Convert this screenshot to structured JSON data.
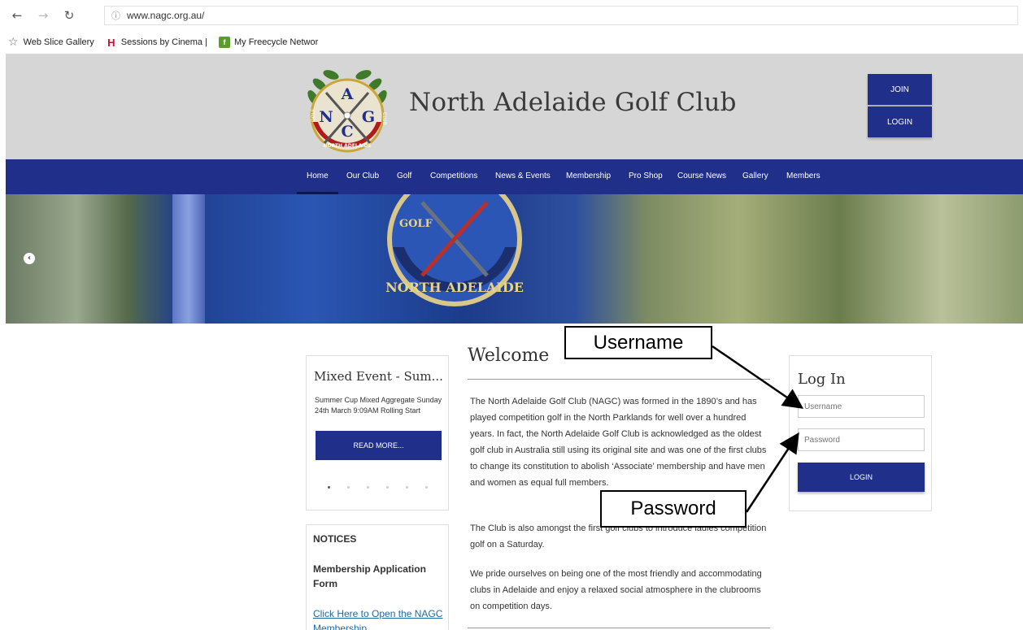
{
  "browser": {
    "back_glyph": "←",
    "forward_glyph": "→",
    "reload_glyph": "↻",
    "info_glyph": "ⓘ",
    "url": "www.nagc.org.au/",
    "favorites_star": "☆",
    "favorites": [
      {
        "label": "Web Slice Gallery",
        "icon": "web-slice-icon"
      },
      {
        "label": "Sessions by Cinema |",
        "icon": "cinema-h-icon"
      },
      {
        "label": "My Freecycle Networ",
        "icon": "freecycle-icon"
      }
    ]
  },
  "header": {
    "site_title": "North Adelaide Golf Club",
    "join_label": "JOIN",
    "login_label": "LOGIN",
    "logo_letters": {
      "a": "A",
      "n": "N",
      "g": "G",
      "c": "C",
      "golf": "GOLF",
      "club": "CLUB",
      "north_adelaide": "NORTH ADELAIDE"
    }
  },
  "nav": {
    "items": [
      "Home",
      "Our Club",
      "Golf",
      "Competitions",
      "News & Events",
      "Membership",
      "Pro Shop",
      "Course News",
      "Gallery",
      "Members"
    ],
    "active": "Home"
  },
  "hero": {
    "prev_glyph": "‹"
  },
  "event": {
    "title": "Mixed Event - Sum...",
    "description": "Summer Cup Mixed Aggregate Sunday 24th March 9:09AM Rolling Start",
    "read_more": "READ MORE..."
  },
  "notices": {
    "heading": "NOTICES",
    "subheading": "Membership Application Form",
    "link_text": "Click Here to Open the NAGC Membership"
  },
  "welcome": {
    "heading": "Welcome",
    "paragraphs": [
      "The North Adelaide Golf Club (NAGC) was formed in the 1890’s and has played competition golf in the North Parklands for well over a hundred years. In fact, the North Adelaide Golf Club is acknowledged as the oldest golf club in Australia still using its original site and was one of the first clubs to change its constitution to abolish ‘Associate’ membership and have men and women as equal full members.",
      "The Club is also amongst the first golf clubs to introduce ladies competition golf on a Saturday.",
      "We pride ourselves on being one of the most friendly and accommodating clubs in Adelaide and enjoy a relaxed social atmosphere in the clubrooms on competition days."
    ]
  },
  "login": {
    "title": "Log In",
    "username_placeholder": "Username",
    "password_placeholder": "Password",
    "button": "LOGIN"
  },
  "annotations": {
    "username": "Username",
    "password": "Password"
  },
  "colors": {
    "brand_blue": "#1f2f8a",
    "header_grey": "#d6d6d6",
    "link_blue": "#1a6aa8"
  }
}
